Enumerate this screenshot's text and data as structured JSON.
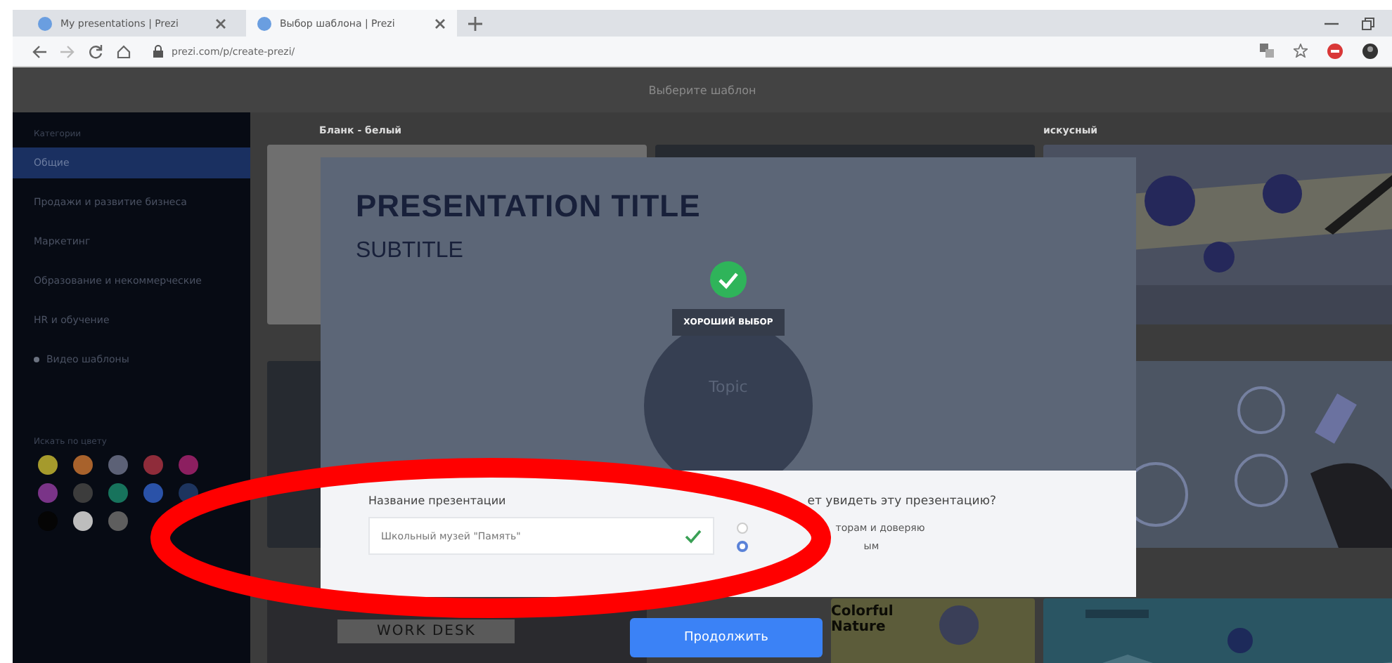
{
  "browser": {
    "tabs": [
      {
        "title": "My presentations | Prezi",
        "selected": false
      },
      {
        "title": "Выбор шаблона | Prezi",
        "selected": true
      }
    ],
    "url": "prezi.com/p/create-prezi/"
  },
  "header": {
    "title": "Выберите шаблон"
  },
  "sidebar": {
    "heading": "Категории",
    "items": [
      {
        "label": "Общие",
        "selected": true,
        "kind": "category"
      },
      {
        "label": "Продажи и развитие бизнеса",
        "selected": false,
        "kind": "category"
      },
      {
        "label": "Маркетинг",
        "selected": false,
        "kind": "category"
      },
      {
        "label": "Образование и некоммерческие",
        "selected": false,
        "kind": "category"
      },
      {
        "label": "HR и обучение",
        "selected": false,
        "kind": "category"
      },
      {
        "label": "Видео шаблоны",
        "selected": false,
        "kind": "video"
      }
    ],
    "color_filter": {
      "label": "Искать по цвету",
      "swatches": [
        {
          "color": "#a59a2c"
        },
        {
          "color": "#a8622c"
        },
        {
          "color": "#5c6176"
        },
        {
          "color": "#8f2c3a"
        },
        {
          "color": "#8c1f60"
        },
        {
          "color": "#7a3488"
        },
        {
          "color": "#3c3c3c"
        },
        {
          "color": "#17735c"
        },
        {
          "color": "#2a52a8"
        },
        {
          "color": "#1d345e"
        },
        {
          "color": "#050505"
        },
        {
          "color": "#bdbdbd"
        },
        {
          "color": "#5e5e5e"
        }
      ]
    }
  },
  "templates": [
    {
      "label": "Бланк - белый",
      "kind": "blank"
    },
    {
      "kind": "dark"
    },
    {
      "label": "искусный",
      "kind": "picture"
    },
    {
      "kind": "dark"
    },
    {
      "kind": "picture"
    },
    {
      "label": "WORK DESK",
      "kind": "desk"
    },
    {
      "label": "Colorful Nature",
      "kind": "nature"
    },
    {
      "kind": "picture"
    }
  ],
  "dialog": {
    "preview": {
      "title": "PRESENTATION TITLE",
      "subtitle": "SUBTITLE",
      "badge": "ХОРОШИЙ ВЫБОР",
      "topic": "Topic"
    },
    "name_label": "Название презентации",
    "name_value": "Школьный музей \"Память\"",
    "name_valid": true,
    "visibility_question": "ет увидеть эту презентацию?",
    "options": [
      {
        "label": "торам и доверяю",
        "selected": false
      },
      {
        "label": "ым",
        "selected": true
      }
    ],
    "continue_button": "Продолжить"
  }
}
